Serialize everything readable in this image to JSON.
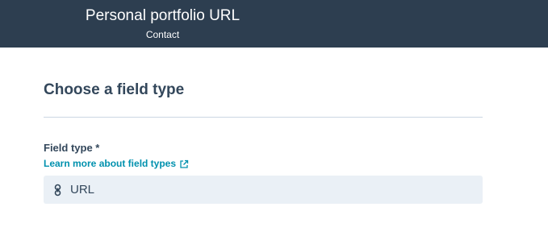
{
  "header": {
    "title": "Personal portfolio URL",
    "subtitle": "Contact"
  },
  "section": {
    "title": "Choose a field type"
  },
  "field": {
    "label": "Field type *",
    "help_link": "Learn more about field types",
    "help_link_icon": "external-link-icon",
    "selected_value": "URL",
    "selected_icon": "link-icon"
  },
  "colors": {
    "header_bg": "#2d3e50",
    "text": "#33475b",
    "link": "#0091ae",
    "select_bg": "#eaf0f6",
    "divider": "#cbd6e2"
  }
}
